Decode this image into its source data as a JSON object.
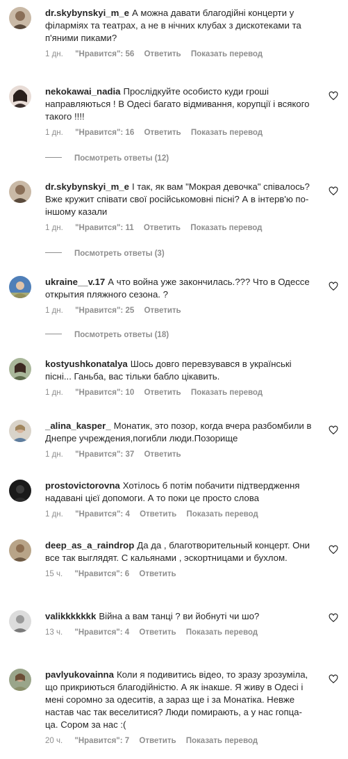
{
  "meta_labels": {
    "likes_prefix": "\"Нравится\":",
    "reply": "Ответить",
    "translate": "Показать перевод"
  },
  "comments": [
    {
      "user": "dr.skybynskyi_m_e",
      "text": "А можна давати благодійні концерти у філарміях та театрах, а не в нічних клубах з дискотеками та п'яними пиками?",
      "time": "1 дн.",
      "likes": "56",
      "show_translate": true
    },
    {
      "user": "nekokawai_nadia",
      "text": "Прослідкуйте особисто куди гроші направляються ! В Одесі багато відмивання, корупції і всякого такого !!!!",
      "time": "1 дн.",
      "likes": "16",
      "show_translate": true,
      "replies": "Посмотреть ответы (12)"
    },
    {
      "user": "dr.skybynskyi_m_e",
      "text": "І так, як вам \"Мокрая девочка\" співалось? Вже кружит співати свої російськомовні пісні? А в інтерв'ю по-іншому казали",
      "time": "1 дн.",
      "likes": "11",
      "show_translate": true,
      "replies": "Посмотреть ответы (3)"
    },
    {
      "user": "ukraine__v.17",
      "text": "А что война уже закончилась.??? Что в Одессе открытия пляжного сезона. ?",
      "time": "1 дн.",
      "likes": "25",
      "show_translate": false,
      "replies": "Посмотреть ответы (18)"
    },
    {
      "user": "kostyushkonatalya",
      "text": "Шось довго перевзувався в українські пісні... Ганьба, вас тільки бабло цікавить.",
      "time": "1 дн.",
      "likes": "10",
      "show_translate": true
    },
    {
      "user": "_alina_kasper_",
      "text": "Монатик, это позор, когда вчера разбомбили в Днепре учреждения,погибли люди.Позорище",
      "time": "1 дн.",
      "likes": "37",
      "show_translate": false
    },
    {
      "user": "prostovictorovna",
      "text": "Хотілось б потім побачити підтвердження надавані цієї допомоги. А то поки це просто слова",
      "time": "1 дн.",
      "likes": "4",
      "show_translate": true
    },
    {
      "user": "deep_as_a_raindrop",
      "text": "Да да , благотворительный концерт. Они все так выглядят. С кальянами , эскортницами и бухлом.",
      "time": "15 ч.",
      "likes": "6",
      "show_translate": false
    },
    {
      "user": "valikkkkkkk",
      "text": "Війна а вам танці ? ви йобнуті чи шо?",
      "time": "13 ч.",
      "likes": "4",
      "show_translate": true
    },
    {
      "user": "pavlyukovainna",
      "text": "Коли я подивитись відео, то зразу зрозуміла, що прикриються благодійністю. А як інакше. Я живу в Одесі і мені соромно за одеситів, а зараз ще і за Монатіка. Невже настав час так веселитися? Люди помирають, а у нас гопца- ца. Сором за нас :(",
      "time": "20 ч.",
      "likes": "7",
      "show_translate": true
    }
  ]
}
